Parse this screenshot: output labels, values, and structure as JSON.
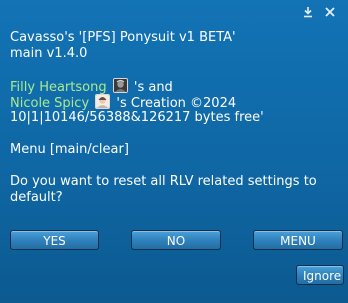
{
  "dialog": {
    "title_line": "Cavasso's '[PFS] Ponysuit v1 BETA'",
    "version_line": "main v1.4.0",
    "person1": "Filly Heartsong",
    "connector": "'s and",
    "person2": "Nicole Spicy",
    "creation_suffix": "'s Creation ©2024",
    "memory_line": "10|1|10146/56388&126217 bytes free'",
    "menu_line": "Menu [main/clear]",
    "question": "Do you want to reset all RLV related settings to default?"
  },
  "buttons": {
    "yes": "YES",
    "no": "NO",
    "menu": "MENU",
    "ignore": "Ignore"
  },
  "icons": {
    "minimize": "download-arrow-icon",
    "close": "close-icon"
  }
}
